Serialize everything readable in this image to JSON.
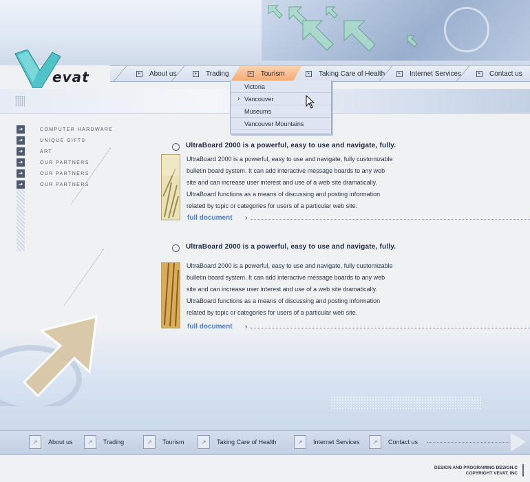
{
  "brand": {
    "logo_text": "evat"
  },
  "nav": {
    "items": [
      {
        "label": "About us"
      },
      {
        "label": "Trading"
      },
      {
        "label": "Tourism"
      },
      {
        "label": "Taking Care of Health"
      },
      {
        "label": "Internet Services"
      },
      {
        "label": "Contact us"
      }
    ],
    "active": "Tourism"
  },
  "dropdown": {
    "items": [
      {
        "label": "Victoria"
      },
      {
        "label": "Vancouver"
      },
      {
        "label": "Museums"
      },
      {
        "label": "Vancouver Mountains"
      }
    ],
    "current": "Vancouver"
  },
  "sidebar": {
    "items": [
      {
        "label": "Computer Hardware"
      },
      {
        "label": "Unique Gifts"
      },
      {
        "label": "Art"
      },
      {
        "label": "Our Partners"
      },
      {
        "label": "Our Partners"
      },
      {
        "label": "Our Partners"
      }
    ]
  },
  "articles": [
    {
      "title": "UltraBoard 2000 is a powerful, easy to use and navigate, fully.",
      "lines": [
        "UltraBoard 2000 is a powerful, easy to use and navigate, fully customizable",
        "bulletin board system. It can add interactive message boards to any web",
        "site and can increase user interest and use of a web site dramatically.",
        "UltraBoard functions as a means of discussing and posting information",
        "related by topic or categories for users of a particular web site."
      ],
      "more": "full document"
    },
    {
      "title": "UltraBoard 2000 is a powerful, easy to use and navigate, fully.",
      "lines": [
        "UltraBoard 2000 is a powerful, easy to use and navigate, fully customizable",
        "bulletin board system. It can add interactive message boards to any web",
        "site and can increase user interest and use of a web site dramatically.",
        "UltraBoard functions as a means of discussing and posting information",
        "related by topic or categories for users of a particular web site."
      ],
      "more": "full document"
    }
  ],
  "footer": {
    "items": [
      {
        "label": "About us"
      },
      {
        "label": "Trading"
      },
      {
        "label": "Tourism"
      },
      {
        "label": "Taking Care of Health"
      },
      {
        "label": "Internet Services"
      },
      {
        "label": "Contact us"
      }
    ],
    "credits": [
      "DESIGN AND PROGRAMING DESIGN.C",
      "COPYRIGHT VEVAT. INC"
    ]
  },
  "colors": {
    "accent": "#f4a870",
    "link": "#4f7dbf",
    "nav_bg": "#d7e0ed",
    "text": "#1c2a45"
  }
}
